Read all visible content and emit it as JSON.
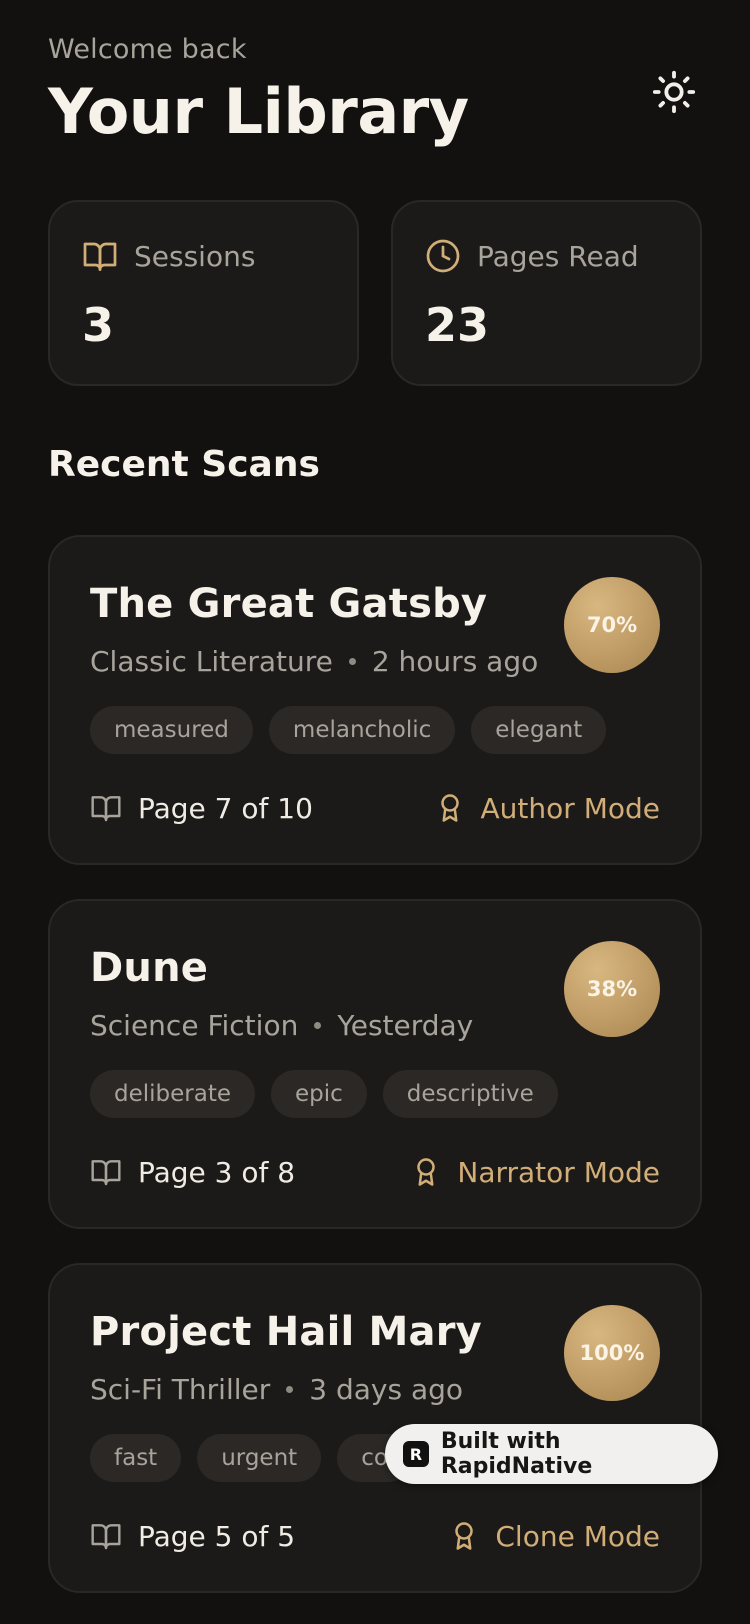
{
  "header": {
    "welcome": "Welcome back",
    "title": "Your Library",
    "theme_icon": "sun-icon"
  },
  "stats": [
    {
      "icon": "book-open-icon",
      "label": "Sessions",
      "value": "3"
    },
    {
      "icon": "clock-icon",
      "label": "Pages Read",
      "value": "23"
    }
  ],
  "recent": {
    "title": "Recent Scans",
    "items": [
      {
        "title": "The Great Gatsby",
        "genre": "Classic Literature",
        "time": "2 hours ago",
        "progress": "70%",
        "tags": [
          "measured",
          "melancholic",
          "elegant"
        ],
        "page": "Page 7 of 10",
        "mode": "Author Mode"
      },
      {
        "title": "Dune",
        "genre": "Science Fiction",
        "time": "Yesterday",
        "progress": "38%",
        "tags": [
          "deliberate",
          "epic",
          "descriptive"
        ],
        "page": "Page 3 of 8",
        "mode": "Narrator Mode"
      },
      {
        "title": "Project Hail Mary",
        "genre": "Sci-Fi Thriller",
        "time": "3 days ago",
        "progress": "100%",
        "tags": [
          "fast",
          "urgent",
          "co"
        ],
        "page": "Page 5 of 5",
        "mode": "Clone Mode"
      }
    ]
  },
  "badge": {
    "logo": "R",
    "label": "Built with RapidNative"
  },
  "colors": {
    "background": "#121110",
    "card": "#1c1a18",
    "accent": "#d1ae78",
    "muted": "#a8a39b"
  }
}
